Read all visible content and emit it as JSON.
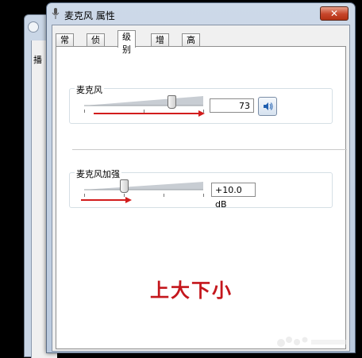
{
  "window": {
    "title": "麦克风 属性",
    "close_label": "✕"
  },
  "tabs": [
    {
      "label": "常规",
      "active": false
    },
    {
      "label": "侦听",
      "active": false
    },
    {
      "label": "级别",
      "active": true
    },
    {
      "label": "增强",
      "active": false
    },
    {
      "label": "高级",
      "active": false
    }
  ],
  "background_window": {
    "tab_label": "播"
  },
  "microphone": {
    "label": "麦克风",
    "level": 73,
    "value_text": "73",
    "speaker_icon": "speaker-icon"
  },
  "boost": {
    "label": "麦克风加强",
    "value_text": "+10.0 dB",
    "level_fraction": 0.33
  },
  "annotation": {
    "text": "上大下小",
    "color": "#c4161c"
  },
  "colors": {
    "arrow": "#d21c1c",
    "title_bar": "#c6d4e6",
    "close_button": "#c6452a"
  }
}
